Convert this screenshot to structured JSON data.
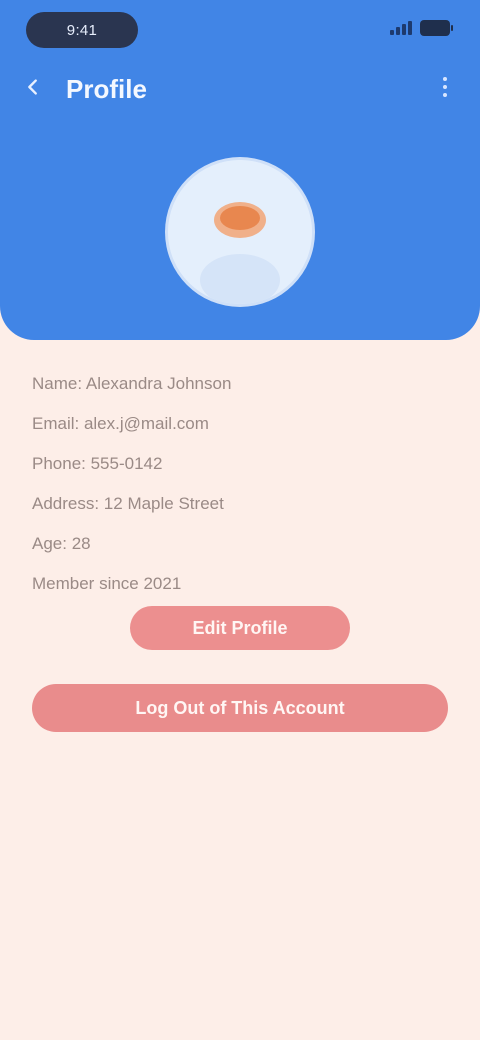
{
  "status_bar": {
    "time": "9:41"
  },
  "header": {
    "title": "Profile",
    "back_icon": "arrow-left-icon",
    "menu_icon": "more-vertical-icon"
  },
  "profile": {
    "avatar_icon": "user-avatar-icon"
  },
  "info": [
    {
      "label": "Name: Alexandra Johnson"
    },
    {
      "label": "Email: alex.j@mail.com"
    },
    {
      "label": "Phone: 555-0142"
    },
    {
      "label": "Address: 12 Maple Street"
    },
    {
      "label": "Age: 28"
    },
    {
      "label": "Member since 2021"
    }
  ],
  "actions": {
    "edit_label": "Edit Profile",
    "logout_label": "Log Out of This Account"
  },
  "colors": {
    "header": "#4185e6",
    "background": "#fdeee8",
    "button": "#ec8f8f"
  }
}
